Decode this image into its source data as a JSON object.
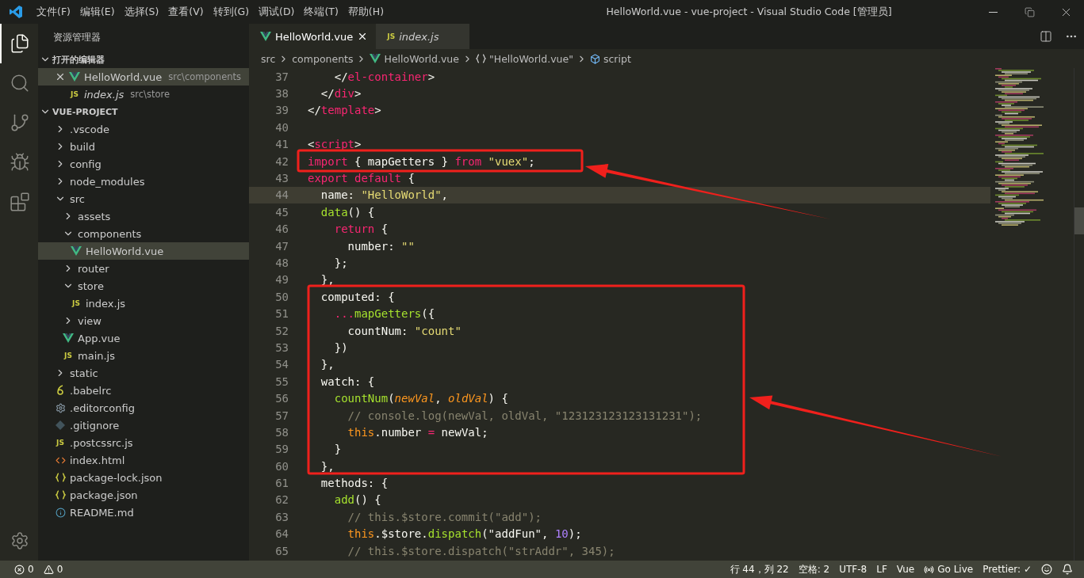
{
  "title_bar": {
    "menu": [
      "文件(F)",
      "编辑(E)",
      "选择(S)",
      "查看(V)",
      "转到(G)",
      "调试(D)",
      "终端(T)",
      "帮助(H)"
    ],
    "title": "HelloWorld.vue - vue-project - Visual Studio Code [管理员]"
  },
  "activity_bar": [
    {
      "kind": "explorer",
      "selected": true
    },
    {
      "kind": "search",
      "selected": false
    },
    {
      "kind": "git",
      "selected": false
    },
    {
      "kind": "debug",
      "selected": false
    },
    {
      "kind": "extensions",
      "selected": false
    }
  ],
  "sidebar": {
    "title": "资源管理器",
    "open_editors": {
      "title": "打开的编辑器",
      "expanded": true,
      "items": [
        {
          "name": "HelloWorld.vue",
          "path": "src\\components",
          "kind": "vue",
          "selected": true,
          "preview": false
        },
        {
          "name": "index.js",
          "path": "src\\store",
          "kind": "js",
          "icon": "JS",
          "selected": false,
          "preview": true
        }
      ]
    },
    "project": {
      "title": "VUE-PROJECT",
      "expanded": true,
      "tree": [
        {
          "name": ".vscode",
          "kind": "folder",
          "expanded": false,
          "selected": false
        },
        {
          "name": "build",
          "kind": "folder",
          "expanded": false,
          "selected": false
        },
        {
          "name": "config",
          "kind": "folder",
          "expanded": false,
          "selected": false
        },
        {
          "name": "node_modules",
          "kind": "folder",
          "expanded": false,
          "selected": false
        },
        {
          "name": "src",
          "kind": "folder",
          "expanded": true,
          "selected": false,
          "children": [
            {
              "name": "assets",
              "kind": "folder",
              "expanded": false,
              "selected": false
            },
            {
              "name": "components",
              "kind": "folder",
              "expanded": true,
              "selected": false,
              "children": [
                {
                  "name": "HelloWorld.vue",
                  "kind": "vue",
                  "selected": true
                }
              ]
            },
            {
              "name": "router",
              "kind": "folder",
              "expanded": false,
              "selected": false
            },
            {
              "name": "store",
              "kind": "folder",
              "expanded": true,
              "selected": false,
              "children": [
                {
                  "name": "index.js",
                  "kind": "js",
                  "icon": "JS",
                  "selected": false
                }
              ]
            },
            {
              "name": "view",
              "kind": "folder",
              "expanded": false,
              "selected": false
            },
            {
              "name": "App.vue",
              "kind": "vue",
              "selected": false
            },
            {
              "name": "main.js",
              "kind": "js",
              "icon": "JS",
              "selected": false
            }
          ]
        },
        {
          "name": "static",
          "kind": "folder",
          "expanded": false,
          "selected": false
        },
        {
          "name": ".babelrc",
          "kind": "babel",
          "selected": false
        },
        {
          "name": ".editorconfig",
          "kind": "config",
          "selected": false
        },
        {
          "name": ".gitignore",
          "kind": "git",
          "selected": false
        },
        {
          "name": ".postcssrc.js",
          "kind": "js",
          "icon": "JS",
          "selected": false
        },
        {
          "name": "index.html",
          "kind": "html",
          "selected": false
        },
        {
          "name": "package-lock.json",
          "kind": "json",
          "selected": false
        },
        {
          "name": "package.json",
          "kind": "json",
          "selected": false
        },
        {
          "name": "README.md",
          "kind": "info",
          "selected": false
        }
      ]
    }
  },
  "tabs": [
    {
      "name": "HelloWorld.vue",
      "kind": "vue",
      "selected": true,
      "preview": false
    },
    {
      "name": "index.js",
      "kind": "js",
      "icon": "JS",
      "selected": false,
      "preview": true
    }
  ],
  "breadcrumbs": [
    {
      "kind": "folder",
      "text": "src"
    },
    {
      "kind": "folder",
      "text": "components"
    },
    {
      "kind": "vue",
      "text": "HelloWorld.vue"
    },
    {
      "kind": "object",
      "text": "\"HelloWorld.vue\""
    },
    {
      "kind": "script",
      "text": "script"
    }
  ],
  "code": [
    {
      "number": "37",
      "current": false,
      "tokens": [
        {
          "kind": "plain",
          "text": "    </"
        },
        {
          "kind": "tag",
          "text": "el-container"
        },
        {
          "kind": "plain",
          "text": ">"
        }
      ]
    },
    {
      "number": "38",
      "current": false,
      "tokens": [
        {
          "kind": "plain",
          "text": "  </"
        },
        {
          "kind": "tag",
          "text": "div"
        },
        {
          "kind": "plain",
          "text": ">"
        }
      ]
    },
    {
      "number": "39",
      "current": false,
      "tokens": [
        {
          "kind": "plain",
          "text": "</"
        },
        {
          "kind": "tag",
          "text": "template"
        },
        {
          "kind": "plain",
          "text": ">"
        }
      ]
    },
    {
      "number": "40",
      "current": false
    },
    {
      "number": "41",
      "current": false,
      "tokens": [
        {
          "kind": "plain",
          "text": "<"
        },
        {
          "kind": "tag",
          "text": "script"
        },
        {
          "kind": "plain",
          "text": ">"
        }
      ]
    },
    {
      "number": "42",
      "current": false,
      "tokens": [
        {
          "kind": "keyword",
          "text": "import"
        },
        {
          "kind": "plain",
          "text": " { mapGetters } "
        },
        {
          "kind": "keyword",
          "text": "from"
        },
        {
          "kind": "string",
          "text": " \"vuex\""
        },
        {
          "kind": "plain",
          "text": ";"
        }
      ]
    },
    {
      "number": "43",
      "current": false,
      "tokens": [
        {
          "kind": "keyword",
          "text": "export default"
        },
        {
          "kind": "plain",
          "text": " {"
        }
      ]
    },
    {
      "number": "44",
      "current": true,
      "tokens": [
        {
          "kind": "plain",
          "text": "  name: "
        },
        {
          "kind": "string",
          "text": "\"HelloWorld\""
        },
        {
          "kind": "plain",
          "text": ","
        }
      ]
    },
    {
      "number": "45",
      "current": false,
      "tokens": [
        {
          "kind": "function",
          "text": "  data"
        },
        {
          "kind": "plain",
          "text": "() {"
        }
      ]
    },
    {
      "number": "46",
      "current": false,
      "tokens": [
        {
          "kind": "keyword",
          "text": "    return"
        },
        {
          "kind": "plain",
          "text": " {"
        }
      ]
    },
    {
      "number": "47",
      "current": false,
      "tokens": [
        {
          "kind": "plain",
          "text": "      number: "
        },
        {
          "kind": "string",
          "text": "\"\""
        }
      ]
    },
    {
      "number": "48",
      "current": false,
      "tokens": [
        {
          "kind": "plain",
          "text": "    };"
        }
      ]
    },
    {
      "number": "49",
      "current": false,
      "tokens": [
        {
          "kind": "plain",
          "text": "  },"
        }
      ]
    },
    {
      "number": "50",
      "current": false,
      "tokens": [
        {
          "kind": "plain",
          "text": "  computed: {"
        }
      ]
    },
    {
      "number": "51",
      "current": false,
      "tokens": [
        {
          "kind": "keyword",
          "text": "    ..."
        },
        {
          "kind": "function",
          "text": "mapGetters"
        },
        {
          "kind": "plain",
          "text": "({"
        }
      ]
    },
    {
      "number": "52",
      "current": false,
      "tokens": [
        {
          "kind": "plain",
          "text": "      countNum: "
        },
        {
          "kind": "string",
          "text": "\"count\""
        }
      ]
    },
    {
      "number": "53",
      "current": false,
      "tokens": [
        {
          "kind": "plain",
          "text": "    })"
        }
      ]
    },
    {
      "number": "54",
      "current": false,
      "tokens": [
        {
          "kind": "plain",
          "text": "  },"
        }
      ]
    },
    {
      "number": "55",
      "current": false,
      "tokens": [
        {
          "kind": "plain",
          "text": "  watch: {"
        }
      ]
    },
    {
      "number": "56",
      "current": false,
      "tokens": [
        {
          "kind": "function",
          "text": "    countNum"
        },
        {
          "kind": "plain",
          "text": "("
        },
        {
          "kind": "param",
          "text": "newVal"
        },
        {
          "kind": "plain",
          "text": ", "
        },
        {
          "kind": "param",
          "text": "oldVal"
        },
        {
          "kind": "plain",
          "text": ") {"
        }
      ]
    },
    {
      "number": "57",
      "current": false,
      "tokens": [
        {
          "kind": "comment",
          "text": "      // console.log(newVal, oldVal, \"123123123123131231\");"
        }
      ]
    },
    {
      "number": "58",
      "current": false,
      "tokens": [
        {
          "kind": "this",
          "text": "      this"
        },
        {
          "kind": "plain",
          "text": ".number "
        },
        {
          "kind": "keyword",
          "text": "="
        },
        {
          "kind": "plain",
          "text": " newVal;"
        }
      ]
    },
    {
      "number": "59",
      "current": false,
      "tokens": [
        {
          "kind": "plain",
          "text": "    }"
        }
      ]
    },
    {
      "number": "60",
      "current": false,
      "tokens": [
        {
          "kind": "plain",
          "text": "  },"
        }
      ]
    },
    {
      "number": "61",
      "current": false,
      "tokens": [
        {
          "kind": "plain",
          "text": "  methods: {"
        }
      ]
    },
    {
      "number": "62",
      "current": false,
      "tokens": [
        {
          "kind": "function",
          "text": "    add"
        },
        {
          "kind": "plain",
          "text": "() {"
        }
      ]
    },
    {
      "number": "63",
      "current": false,
      "tokens": [
        {
          "kind": "comment",
          "text": "      // this.$store.commit(\"add\");"
        }
      ]
    },
    {
      "number": "64",
      "current": false,
      "tokens": [
        {
          "kind": "this",
          "text": "      this"
        },
        {
          "kind": "plain",
          "text": ".$store."
        },
        {
          "kind": "function",
          "text": "dispatch"
        },
        {
          "kind": "plain",
          "text": "(\"addFun\", "
        },
        {
          "kind": "number",
          "text": "10"
        },
        {
          "kind": "plain",
          "text": ");"
        }
      ]
    },
    {
      "number": "65",
      "current": false,
      "tokens": [
        {
          "kind": "comment",
          "text": "      // this.$store.dispatch(\"strAddr\", 345);"
        }
      ]
    }
  ],
  "annotations": [
    {
      "kind": "box"
    },
    {
      "kind": "arrow"
    },
    {
      "kind": "box"
    },
    {
      "kind": "arrow"
    }
  ],
  "status_bar": {
    "left": [
      {
        "kind": "error",
        "text": "0"
      },
      {
        "kind": "warning",
        "text": "0"
      }
    ],
    "right": [
      {
        "kind": "text",
        "text": "行 44，列 22"
      },
      {
        "kind": "text",
        "text": "空格: 2"
      },
      {
        "kind": "text",
        "text": "UTF-8"
      },
      {
        "kind": "text",
        "text": "LF"
      },
      {
        "kind": "text",
        "text": "Vue"
      },
      {
        "kind": "live",
        "text": "Go Live"
      },
      {
        "kind": "text",
        "text": "Prettier: ✓"
      },
      {
        "kind": "feedback"
      },
      {
        "kind": "bell"
      }
    ]
  }
}
